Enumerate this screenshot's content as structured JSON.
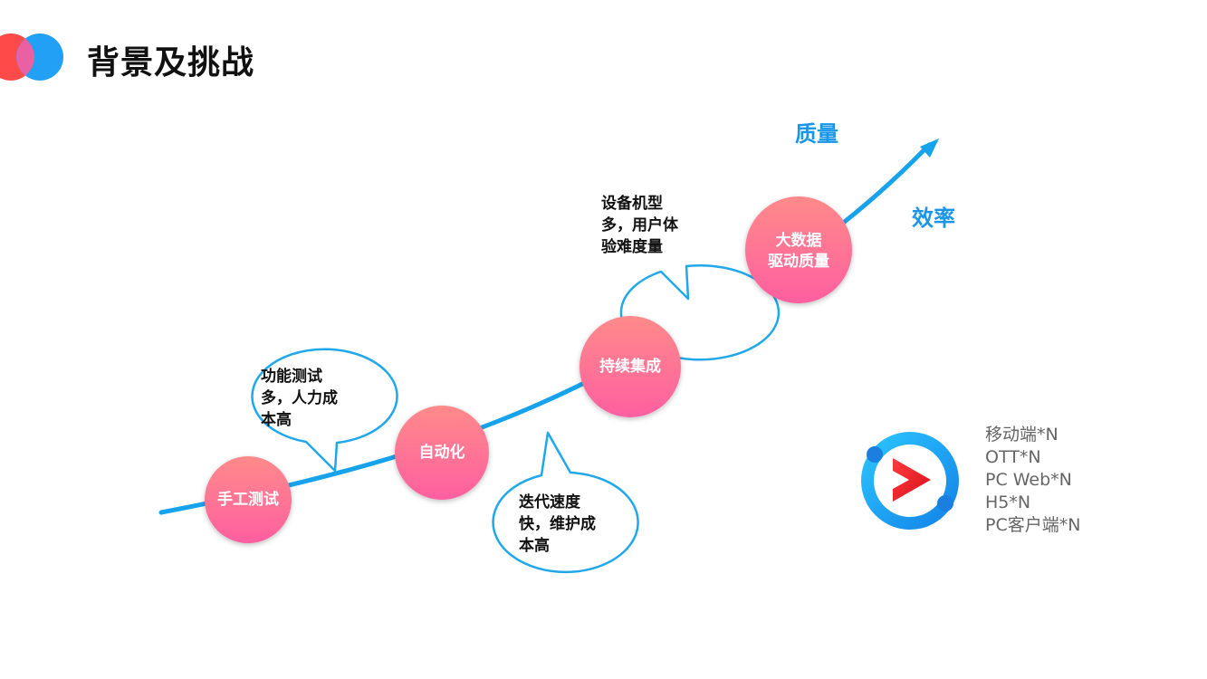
{
  "page": {
    "title": "背景及挑战"
  },
  "axis": {
    "quality": "质量",
    "efficiency": "效率"
  },
  "stages": [
    {
      "id": "manual",
      "lines": [
        "手工测试"
      ]
    },
    {
      "id": "auto",
      "lines": [
        "自动化"
      ]
    },
    {
      "id": "ci",
      "lines": [
        "持续集成"
      ]
    },
    {
      "id": "bigdata",
      "lines": [
        "大数据",
        "驱动质量"
      ]
    }
  ],
  "challenges": [
    {
      "id": "manual",
      "lines": [
        "功能测试",
        "多，人力成",
        "本高"
      ]
    },
    {
      "id": "auto",
      "lines": [
        "迭代速度",
        "快，维护成",
        "本高"
      ]
    },
    {
      "id": "ci",
      "lines": [
        "设备机型",
        "多，用户体",
        "验难度量"
      ]
    }
  ],
  "platforms": [
    "移动端*N",
    "OTT*N",
    "PC Web*N",
    "H5*N",
    "PC客户端*N"
  ],
  "colors": {
    "curve": "#17a3ec",
    "axis_label": "#1a96e8",
    "node_top": "#ff8a8a",
    "node_bottom": "#ff5fa0",
    "bubble_stroke": "#20a8ea",
    "logo_red": "#ff4a4a",
    "logo_blue": "#21a0f5",
    "play_red": "#e8232a",
    "ring_blue": "#1b9ff0"
  },
  "icons": {
    "logo": "overlapping-circles-logo",
    "platform": "youku-play-icon"
  }
}
